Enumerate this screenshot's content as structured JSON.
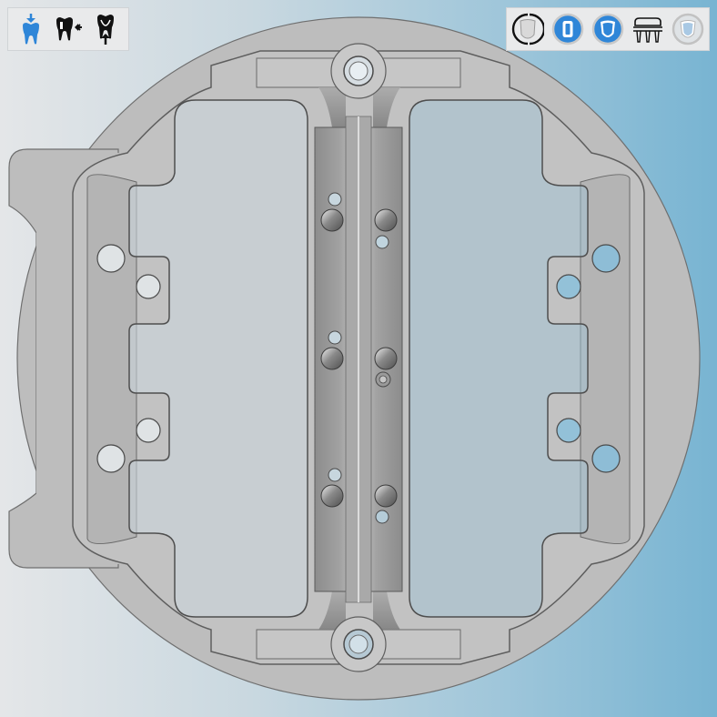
{
  "app": {
    "background_colors": [
      "#e4e6e8",
      "#c9d8e0",
      "#9fc6da",
      "#78b4d2"
    ],
    "accent_color": "#2f86d8",
    "part_color": "#bdbdbd"
  },
  "toolbar_left": {
    "items": [
      {
        "icon": "tooth-insert-icon",
        "active": true
      },
      {
        "icon": "tooth-move-left-icon",
        "active": false
      },
      {
        "icon": "tooth-lift-icon",
        "active": false
      }
    ]
  },
  "toolbar_right": {
    "items": [
      {
        "icon": "rotate-view-icon",
        "active": false
      },
      {
        "icon": "tooth-view-front-icon",
        "active": true
      },
      {
        "icon": "tooth-view-side-icon",
        "active": true
      },
      {
        "icon": "dental-bridge-icon",
        "active": false
      },
      {
        "icon": "tooth-view-transparent-icon",
        "active": false
      }
    ]
  }
}
